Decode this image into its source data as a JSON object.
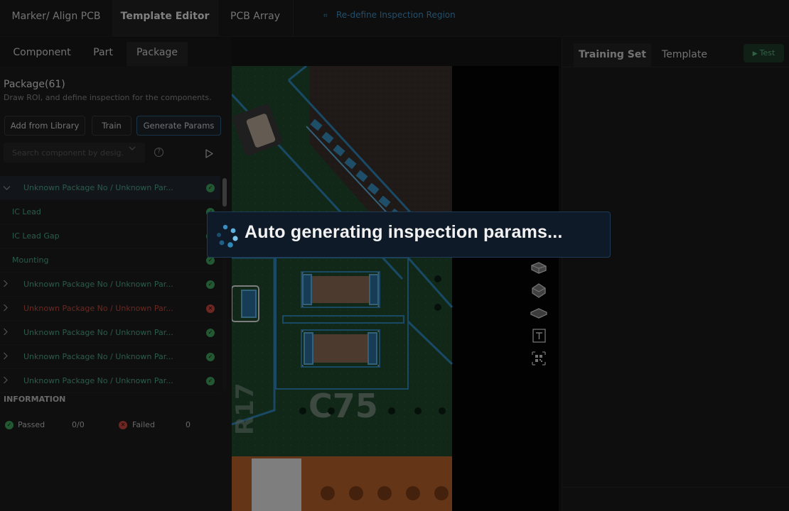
{
  "topnav": {
    "tabs": [
      {
        "label": "Marker/ Align PCB",
        "active": false
      },
      {
        "label": "Template Editor",
        "active": true
      },
      {
        "label": "PCB Array",
        "active": false
      }
    ],
    "redefine_label": "Re-define Inspection Region"
  },
  "left": {
    "subtabs": [
      {
        "label": "Component",
        "active": false
      },
      {
        "label": "Part",
        "active": false
      },
      {
        "label": "Package",
        "active": true
      }
    ],
    "title": "Package(61)",
    "description": "Draw ROI, and define inspection for the components.",
    "buttons": {
      "add_from_library": "Add from Library",
      "train": "Train",
      "generate_params": "Generate Params"
    },
    "search_placeholder": "Search component by desig...",
    "help_glyph": "?",
    "list": [
      {
        "type": "group",
        "label": "Unknown Package No / Unknown Par...",
        "expanded": true,
        "status": "pass"
      },
      {
        "type": "child",
        "label": "IC Lead",
        "status": "pass"
      },
      {
        "type": "child",
        "label": "IC Lead Gap",
        "status": "pass"
      },
      {
        "type": "child",
        "label": "Mounting",
        "status": "pass"
      },
      {
        "type": "group",
        "label": "Unknown Package No / Unknown Par...",
        "expanded": false,
        "status": "pass"
      },
      {
        "type": "group",
        "label": "Unknown Package No / Unknown Par...",
        "expanded": false,
        "status": "fail"
      },
      {
        "type": "group",
        "label": "Unknown Package No / Unknown Par...",
        "expanded": false,
        "status": "pass"
      },
      {
        "type": "group",
        "label": "Unknown Package No / Unknown Par...",
        "expanded": false,
        "status": "pass"
      },
      {
        "type": "group",
        "label": "Unknown Package No / Unknown Par...",
        "expanded": false,
        "status": "pass"
      }
    ],
    "info": {
      "title": "INFORMATION",
      "passed_label": "Passed",
      "passed_value": "0/0",
      "failed_label": "Failed",
      "failed_value": "0"
    }
  },
  "right": {
    "tabs": [
      {
        "label": "Training Set",
        "active": true
      },
      {
        "label": "Template",
        "active": false
      }
    ],
    "test_label": "Test"
  },
  "tools": [
    "chip-icon",
    "package-3d-icon",
    "flat-package-icon",
    "text-tool-icon",
    "qr-code-icon"
  ],
  "colors": {
    "pass": "#3ea35b",
    "fail": "#c7463c",
    "accent": "#3f8fc0",
    "roi": "#2f86b8"
  },
  "toast": {
    "message": "Auto generating inspection params..."
  }
}
